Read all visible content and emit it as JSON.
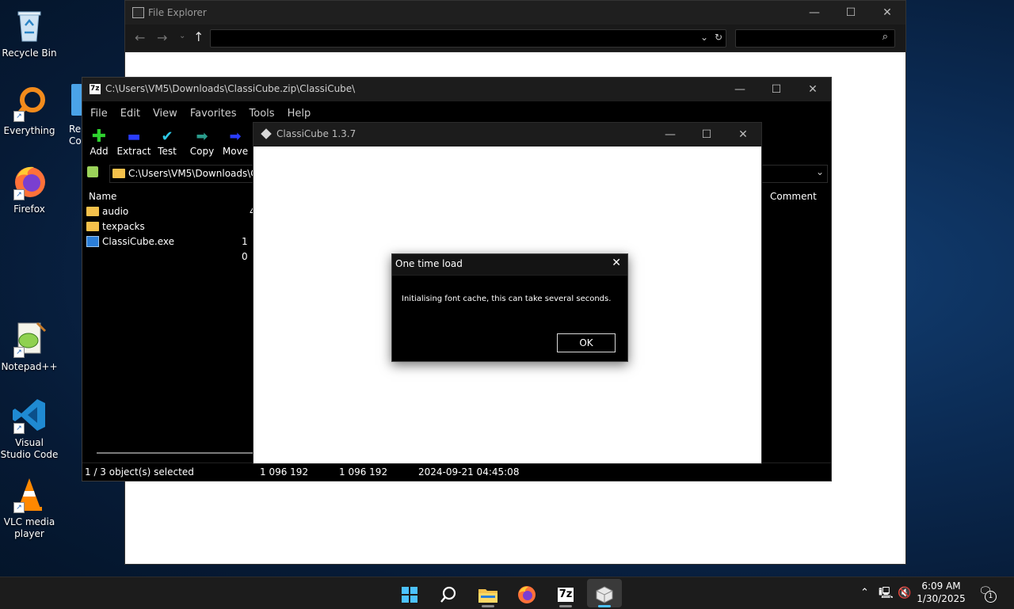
{
  "desktop": {
    "icons": [
      {
        "label": "Recycle Bin"
      },
      {
        "label": "Everything"
      },
      {
        "label": "Firefox"
      },
      {
        "label": "Notepad++"
      },
      {
        "label": "Visual Studio Code"
      },
      {
        "label": "VLC media player"
      }
    ],
    "partial_icon": {
      "label": "Re Co"
    }
  },
  "file_explorer": {
    "title": "File Explorer",
    "address_value": "",
    "search_value": ""
  },
  "sevenzip": {
    "title": "C:\\Users\\VM5\\Downloads\\ClassiCube.zip\\ClassiCube\\",
    "icon_text": "7z",
    "menu": [
      "File",
      "Edit",
      "View",
      "Favorites",
      "Tools",
      "Help"
    ],
    "tools": [
      "Add",
      "Extract",
      "Test",
      "Copy",
      "Move"
    ],
    "address": "C:\\Users\\VM5\\Downloads\\Cla",
    "columns": {
      "name": "Name",
      "comment": "Comment"
    },
    "rows": [
      {
        "name": "audio",
        "size": "4",
        "type": "folder"
      },
      {
        "name": "texpacks",
        "size": "",
        "type": "folder"
      },
      {
        "name": "ClassiCube.exe",
        "size": "1 0",
        "type": "exe"
      }
    ],
    "status": {
      "selected": "1 / 3 object(s) selected",
      "size": "1 096 192",
      "packed": "1 096 192",
      "modified": "2024-09-21 04:45:08"
    }
  },
  "classicube": {
    "title": "ClassiCube 1.3.7"
  },
  "dialog": {
    "title": "One time load",
    "message": "Initialising font cache, this can take several seconds.",
    "ok_label": "OK"
  },
  "taskbar": {
    "apps": [
      "start-icon",
      "search-icon",
      "file-explorer-icon",
      "firefox-icon",
      "7zip-icon",
      "classicube-icon"
    ],
    "sevenzip_label": "7z",
    "time": "6:09 AM",
    "date": "1/30/2025",
    "notification_count": "1"
  }
}
